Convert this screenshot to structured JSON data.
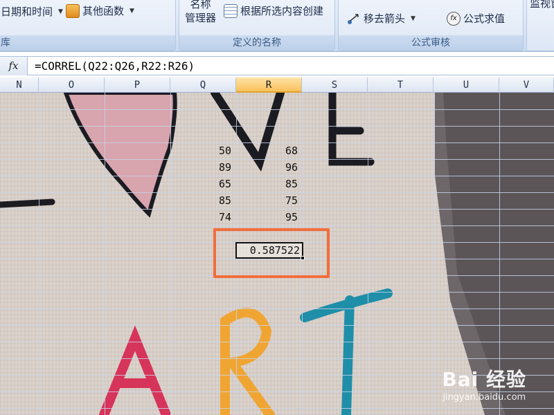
{
  "ribbon": {
    "groups": [
      {
        "label": "库"
      },
      {
        "label": "定义的名称"
      },
      {
        "label": "公式审核"
      }
    ],
    "date_time_label": "日期和时间",
    "other_functions_label": "其他函数",
    "name_manager_label_1": "名称",
    "name_manager_label_2": "管理器",
    "create_from_selection_label": "根据所选内容创建",
    "remove_arrows_label": "移去箭头",
    "evaluate_formula_label": "公式求值",
    "watch_label": "监视窗"
  },
  "formula_bar": {
    "fx_label": "fx",
    "formula": "=CORREL(Q22:Q26,R22:R26)"
  },
  "sheet": {
    "columns": [
      "N",
      "O",
      "P",
      "Q",
      "R",
      "S",
      "T",
      "U",
      "V"
    ],
    "selected_column": "R",
    "q_values": [
      "50",
      "89",
      "65",
      "85",
      "74"
    ],
    "r_values": [
      "68",
      "96",
      "85",
      "75",
      "95"
    ],
    "result": "0.587522"
  },
  "watermark": {
    "logo": "Bai 经验",
    "url": "jingyan.baidu.com"
  },
  "colors": {
    "highlight": "#f26d3d",
    "selected_header": "#f7c15c"
  }
}
